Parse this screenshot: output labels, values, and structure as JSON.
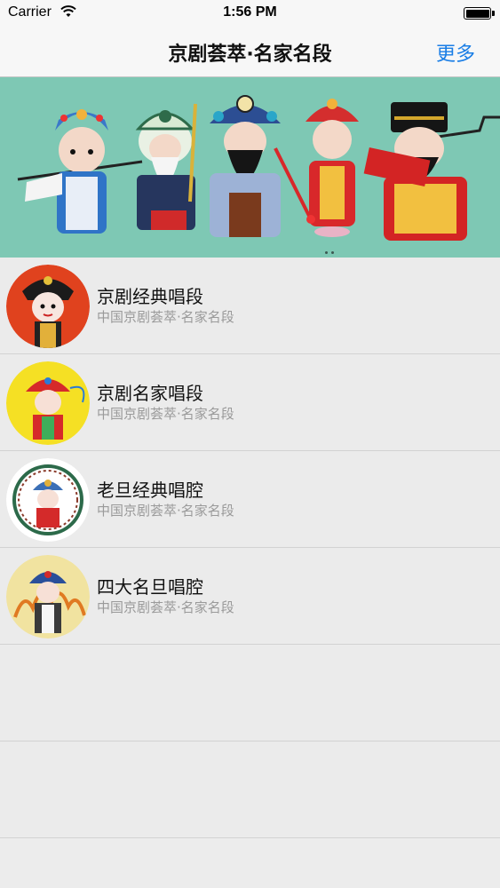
{
  "status_bar": {
    "carrier": "Carrier",
    "time": "1:56 PM",
    "wifi_icon": "wifi-icon",
    "battery_icon": "battery-full-icon"
  },
  "nav": {
    "title": "京剧荟萃·名家名段",
    "more_label": "更多"
  },
  "banner": {
    "page_count": 2,
    "current_page": 1,
    "background_color": "#7ec8b4"
  },
  "list": {
    "items": [
      {
        "title": "京剧经典唱段",
        "subtitle": "中国京剧荟萃·名家名段",
        "thumb_bg": "#e0421e"
      },
      {
        "title": "京剧名家唱段",
        "subtitle": "中国京剧荟萃·名家名段",
        "thumb_bg": "#f5e024"
      },
      {
        "title": "老旦经典唱腔",
        "subtitle": "中国京剧荟萃·名家名段",
        "thumb_bg": "#ffffff"
      },
      {
        "title": "四大名旦唱腔",
        "subtitle": "中国京剧荟萃·名家名段",
        "thumb_bg": "#f1e3a0"
      }
    ]
  },
  "colors": {
    "accent": "#1a7ee6",
    "background": "#ececec"
  }
}
